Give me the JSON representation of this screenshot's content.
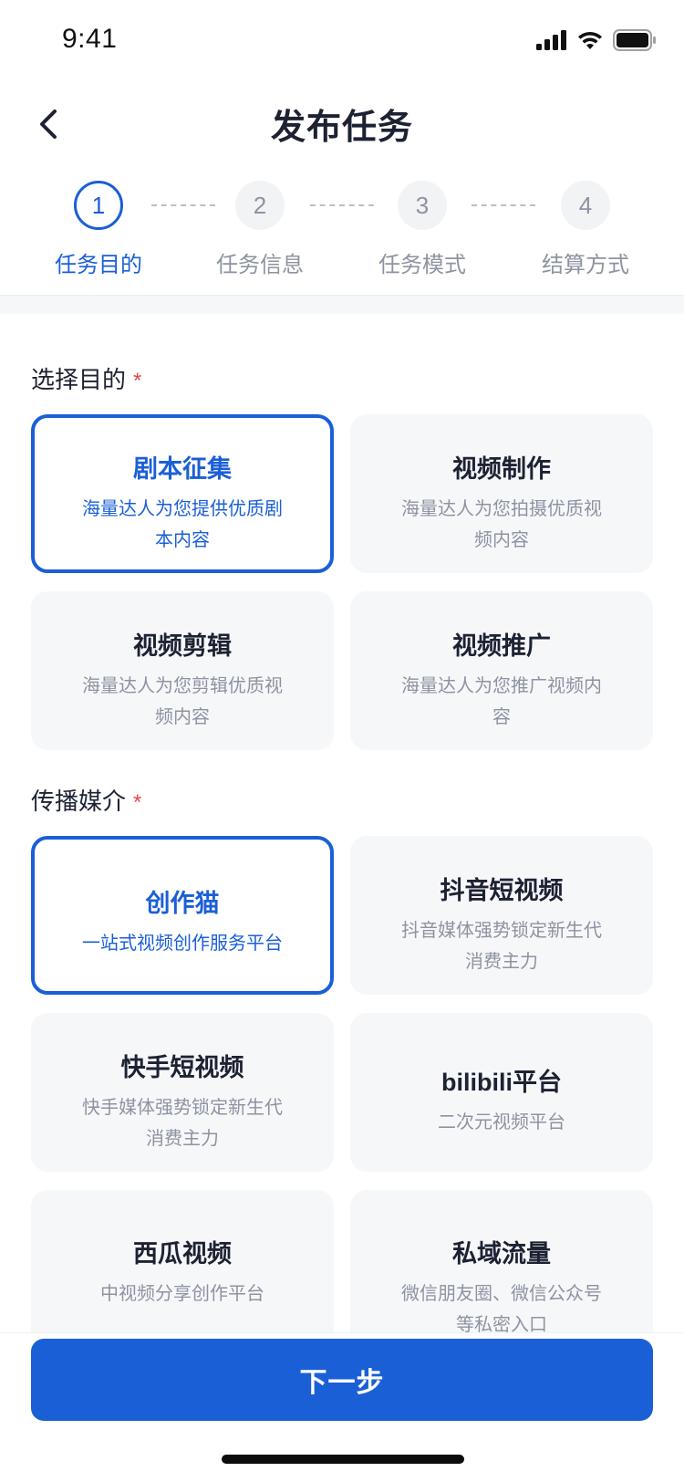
{
  "status_bar": {
    "time": "9:41"
  },
  "header": {
    "title": "发布任务"
  },
  "stepper": {
    "steps": [
      {
        "number": "1",
        "label": "任务目的"
      },
      {
        "number": "2",
        "label": "任务信息"
      },
      {
        "number": "3",
        "label": "任务模式"
      },
      {
        "number": "4",
        "label": "结算方式"
      }
    ]
  },
  "purpose": {
    "title": "选择目的",
    "required_mark": "*",
    "options": [
      {
        "title": "剧本征集",
        "desc": "海量达人为您提供优质剧本内容"
      },
      {
        "title": "视频制作",
        "desc": "海量达人为您拍摄优质视频内容"
      },
      {
        "title": "视频剪辑",
        "desc": "海量达人为您剪辑优质视频内容"
      },
      {
        "title": "视频推广",
        "desc": "海量达人为您推广视频内容"
      }
    ]
  },
  "medium": {
    "title": "传播媒介",
    "required_mark": "*",
    "options": [
      {
        "title": "创作猫",
        "desc": "一站式视频创作服务平台"
      },
      {
        "title": "抖音短视频",
        "desc": "抖音媒体强势锁定新生代消费主力"
      },
      {
        "title": "快手短视频",
        "desc": "快手媒体强势锁定新生代消费主力"
      },
      {
        "title": "bilibili平台",
        "desc": "二次元视频平台"
      },
      {
        "title": "西瓜视频",
        "desc": "中视频分享创作平台"
      },
      {
        "title": "私域流量",
        "desc": "微信朋友圈、微信公众号等私密入口"
      }
    ]
  },
  "footer": {
    "next_label": "下一步"
  },
  "colors": {
    "accent": "#1a5fd6",
    "required": "#e14b4b"
  }
}
